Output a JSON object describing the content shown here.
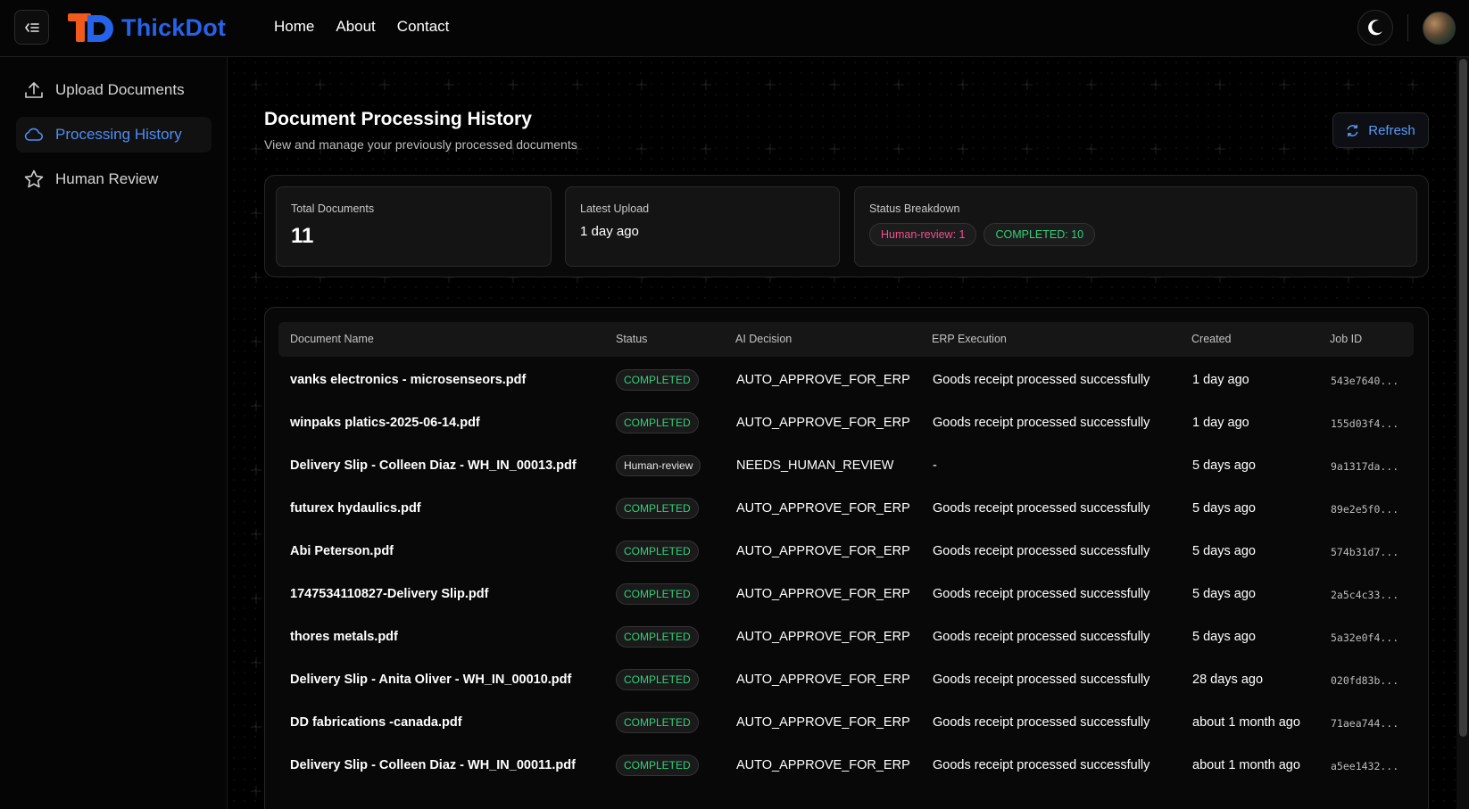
{
  "header": {
    "brand": "ThickDot",
    "nav": [
      {
        "label": "Home"
      },
      {
        "label": "About"
      },
      {
        "label": "Contact"
      }
    ],
    "brand_color": "#2563eb",
    "logo_accent": "#f05a1a"
  },
  "sidebar": {
    "items": [
      {
        "label": "Upload Documents",
        "icon": "upload-icon",
        "active": false
      },
      {
        "label": "Processing History",
        "icon": "cloud-icon",
        "active": true
      },
      {
        "label": "Human Review",
        "icon": "star-icon",
        "active": false
      }
    ]
  },
  "main": {
    "title": "Document Processing History",
    "subtitle": "View and manage your previously processed documents",
    "refresh_label": "Refresh",
    "stats": {
      "total_label": "Total Documents",
      "total_value": "11",
      "latest_label": "Latest Upload",
      "latest_value": "1 day ago",
      "breakdown_label": "Status Breakdown",
      "badges": [
        {
          "label": "Human-review: 1",
          "color": "#f0508f"
        },
        {
          "label": "COMPLETED: 10",
          "color": "#31d07a"
        }
      ]
    },
    "table": {
      "columns": [
        "Document Name",
        "Status",
        "AI Decision",
        "ERP Execution",
        "Created",
        "Job ID"
      ],
      "rows": [
        {
          "name": "vanks electronics - microsenseors.pdf",
          "status": "COMPLETED",
          "decision": "AUTO_APPROVE_FOR_ERP",
          "erp": "Goods receipt processed successfully",
          "created": "1 day ago",
          "job": "543e7640..."
        },
        {
          "name": "winpaks platics-2025-06-14.pdf",
          "status": "COMPLETED",
          "decision": "AUTO_APPROVE_FOR_ERP",
          "erp": "Goods receipt processed successfully",
          "created": "1 day ago",
          "job": "155d03f4..."
        },
        {
          "name": "Delivery Slip - Colleen Diaz - WH_IN_00013.pdf",
          "status": "Human-review",
          "decision": "NEEDS_HUMAN_REVIEW",
          "erp": "-",
          "created": "5 days ago",
          "job": "9a1317da..."
        },
        {
          "name": "futurex hydaulics.pdf",
          "status": "COMPLETED",
          "decision": "AUTO_APPROVE_FOR_ERP",
          "erp": "Goods receipt processed successfully",
          "created": "5 days ago",
          "job": "89e2e5f0..."
        },
        {
          "name": "Abi Peterson.pdf",
          "status": "COMPLETED",
          "decision": "AUTO_APPROVE_FOR_ERP",
          "erp": "Goods receipt processed successfully",
          "created": "5 days ago",
          "job": "574b31d7..."
        },
        {
          "name": "1747534110827-Delivery Slip.pdf",
          "status": "COMPLETED",
          "decision": "AUTO_APPROVE_FOR_ERP",
          "erp": "Goods receipt processed successfully",
          "created": "5 days ago",
          "job": "2a5c4c33..."
        },
        {
          "name": "thores metals.pdf",
          "status": "COMPLETED",
          "decision": "AUTO_APPROVE_FOR_ERP",
          "erp": "Goods receipt processed successfully",
          "created": "5 days ago",
          "job": "5a32e0f4..."
        },
        {
          "name": "Delivery Slip - Anita Oliver - WH_IN_00010.pdf",
          "status": "COMPLETED",
          "decision": "AUTO_APPROVE_FOR_ERP",
          "erp": "Goods receipt processed successfully",
          "created": "28 days ago",
          "job": "020fd83b..."
        },
        {
          "name": "DD fabrications -canada.pdf",
          "status": "COMPLETED",
          "decision": "AUTO_APPROVE_FOR_ERP",
          "erp": "Goods receipt processed successfully",
          "created": "about 1 month ago",
          "job": "71aea744..."
        },
        {
          "name": "Delivery Slip - Colleen Diaz - WH_IN_00011.pdf",
          "status": "COMPLETED",
          "decision": "AUTO_APPROVE_FOR_ERP",
          "erp": "Goods receipt processed successfully",
          "created": "about 1 month ago",
          "job": "a5ee1432..."
        }
      ]
    }
  }
}
